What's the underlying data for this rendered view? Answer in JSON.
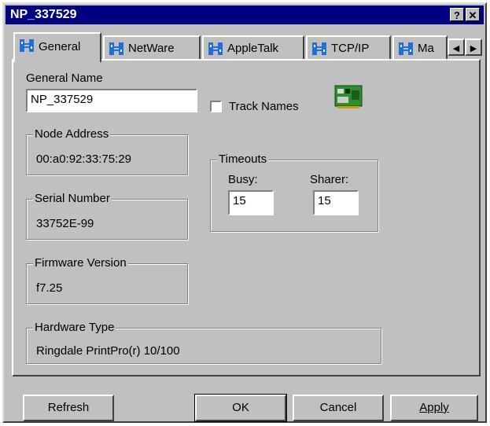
{
  "window": {
    "title": "NP_337529",
    "help_button": "?",
    "close_button": "✕"
  },
  "tabs": [
    {
      "label": "General",
      "active": true
    },
    {
      "label": "NetWare",
      "active": false
    },
    {
      "label": "AppleTalk",
      "active": false
    },
    {
      "label": "TCP/IP",
      "active": false
    },
    {
      "label": "Ma",
      "active": false
    }
  ],
  "tab_scroll": {
    "left": "◀",
    "right": "▶"
  },
  "general": {
    "general_name_label": "General Name",
    "general_name_value": "NP_337529",
    "track_names_label": "Track Names",
    "track_names_checked": false,
    "node_address": {
      "label": "Node Address",
      "value": "00:a0:92:33:75:29"
    },
    "serial_number": {
      "label": "Serial Number",
      "value": "33752E-99"
    },
    "firmware_version": {
      "label": "Firmware Version",
      "value": "f7.25"
    },
    "hardware_type": {
      "label": "Hardware Type",
      "value": "Ringdale PrintPro(r) 10/100"
    },
    "timeouts": {
      "label": "Timeouts",
      "busy_label": "Busy:",
      "busy_value": "15",
      "sharer_label": "Sharer:",
      "sharer_value": "15"
    }
  },
  "buttons": {
    "refresh": "Refresh",
    "ok": "OK",
    "cancel": "Cancel",
    "apply": "Apply"
  },
  "colors": {
    "title_bar": "#000080",
    "face": "#c0c0c0",
    "icon_blue": "#1e6fd9",
    "icon_green": "#2f8f2f"
  }
}
